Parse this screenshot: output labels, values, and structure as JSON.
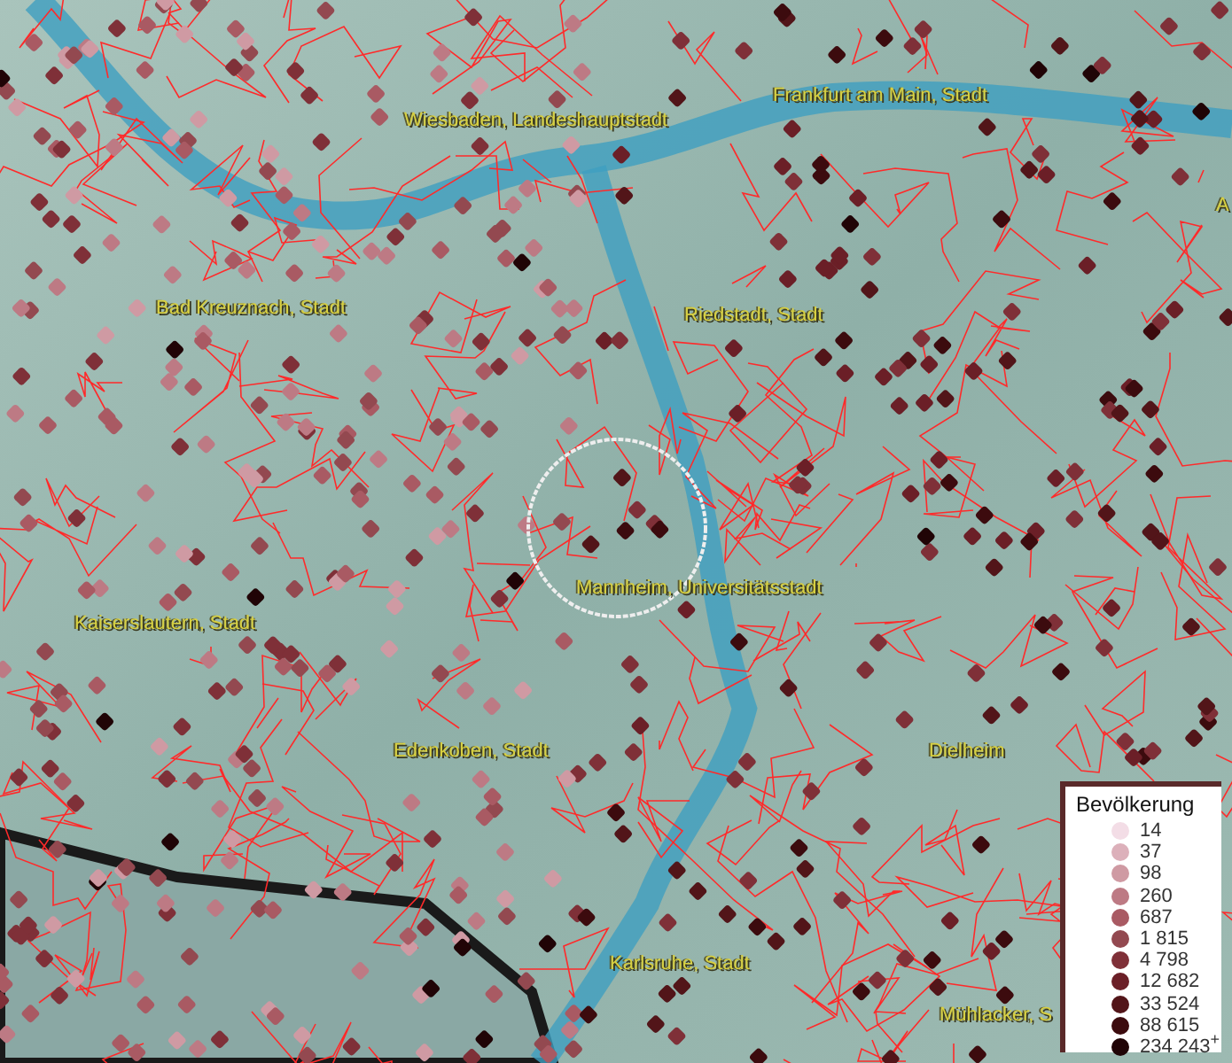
{
  "map": {
    "place_labels": [
      "Wiesbaden, Landeshauptstadt",
      "Frankfurt am Main, Stadt",
      "A",
      "Bad Kreuznach, Stadt",
      "Riedstadt, Stadt",
      "Mannheim, Universitätsstadt",
      "Kaiserslautern, Stadt",
      "Edenkoben, Stadt",
      "Dielheim",
      "Karlsruhe, Stadt",
      "Mühlacker, S"
    ]
  },
  "legend": {
    "title": "Bevölkerung",
    "classes": [
      {
        "label": "14",
        "color": "#f3dde6"
      },
      {
        "label": "37",
        "color": "#dcb0ba"
      },
      {
        "label": "98",
        "color": "#cf9aa3"
      },
      {
        "label": "260",
        "color": "#bd7a84"
      },
      {
        "label": "687",
        "color": "#a95a63"
      },
      {
        "label": "1 815",
        "color": "#934950"
      },
      {
        "label": "4 798",
        "color": "#7f3038"
      },
      {
        "label": "12 682",
        "color": "#6b1f27"
      },
      {
        "label": "33 524",
        "color": "#521519"
      },
      {
        "label": "88 615",
        "color": "#3c0b0e"
      },
      {
        "label": "234 243$^{+}$",
        "color": "#200406"
      }
    ]
  }
}
